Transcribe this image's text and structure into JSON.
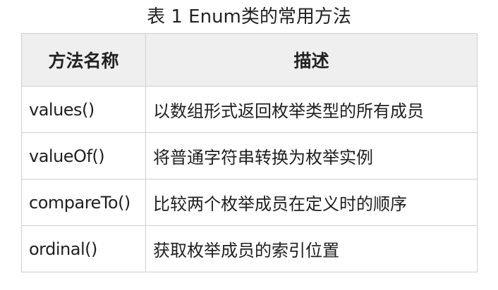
{
  "caption": "表 1 Enum类的常用方法",
  "table": {
    "headers": [
      "方法名称",
      "描述"
    ],
    "rows": [
      {
        "method": "values()",
        "description": "以数组形式返回枚举类型的所有成员"
      },
      {
        "method": "valueOf()",
        "description": "将普通字符串转换为枚举实例"
      },
      {
        "method": "compareTo()",
        "description": "比较两个枚举成员在定义时的顺序"
      },
      {
        "method": "ordinal()",
        "description": "获取枚举成员的索引位置"
      }
    ]
  }
}
